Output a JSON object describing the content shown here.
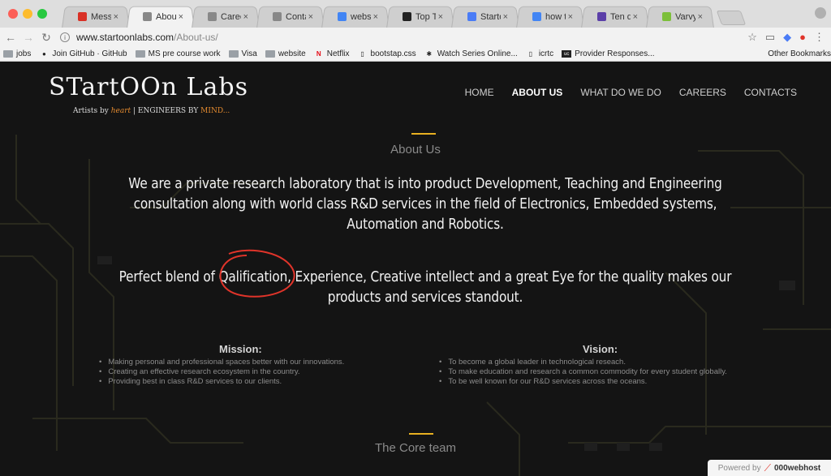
{
  "browser": {
    "tabs": [
      {
        "title": "Message (",
        "icon": "gmail-icon",
        "color": "#d93025"
      },
      {
        "title": "About",
        "icon": "page-icon",
        "color": "#888888",
        "active": true
      },
      {
        "title": "Careers",
        "icon": "page-icon",
        "color": "#888888"
      },
      {
        "title": "Contacts",
        "icon": "page-icon",
        "color": "#888888"
      },
      {
        "title": "website de",
        "icon": "google-icon",
        "color": "#4285f4"
      },
      {
        "title": "Top Ten Re",
        "icon": "logo-icon",
        "color": "#222222"
      },
      {
        "title": "Startoonla",
        "icon": "docs-icon",
        "color": "#4a7cf6"
      },
      {
        "title": "how to tes",
        "icon": "google-icon",
        "color": "#4285f4"
      },
      {
        "title": "Ten quick",
        "icon": "w-icon",
        "color": "#5b3fa8"
      },
      {
        "title": "Varvy SEO",
        "icon": "leaf-icon",
        "color": "#7cbf3a"
      }
    ],
    "url_host": "www.startoonlabs.com",
    "url_path": "/About-us/",
    "bookmarks": [
      {
        "label": "jobs",
        "icon": "folder-icon"
      },
      {
        "label": "Join GitHub · GitHub",
        "icon": "github-icon"
      },
      {
        "label": "MS pre course work",
        "icon": "folder-icon"
      },
      {
        "label": "Visa",
        "icon": "folder-icon"
      },
      {
        "label": "website",
        "icon": "folder-icon"
      },
      {
        "label": "Netflix",
        "icon": "netflix-icon"
      },
      {
        "label": "bootstap.css",
        "icon": "file-icon"
      },
      {
        "label": "Watch Series Online...",
        "icon": "series-icon"
      },
      {
        "label": "icrtc",
        "icon": "file-icon"
      },
      {
        "label": "Provider Responses...",
        "icon": "uc-icon"
      }
    ],
    "other_bookmarks": "Other Bookmarks"
  },
  "site": {
    "logo_text": "STartOOn Labs",
    "tagline_pre": "Artists by ",
    "tagline_heart": "heart",
    "tagline_mid": " | ENGINEERS BY ",
    "tagline_mind": "MIND...",
    "nav": [
      "HOME",
      "ABOUT US",
      "WHAT DO WE DO",
      "CAREERS",
      "CONTACTS"
    ],
    "nav_active": "ABOUT US"
  },
  "about": {
    "title": "About Us",
    "p1_l1": "We are a private research laboratory that is into product Development, Teaching and Engineering",
    "p1_l2": "consultation along with world class R&D services in the field of Electronics, Embedded systems,",
    "p1_l3": "Automation and Robotics.",
    "p2_l1": "Perfect blend of Qalification, Experience, Creative intellect and a great Eye for the quality makes our",
    "p2_l2": "products and services standout."
  },
  "mission": {
    "title": "Mission:",
    "items": [
      "Making personal and professional spaces better with our innovations.",
      "Creating an effective research ecosystem in the country.",
      "Providing best in class R&D services to our clients."
    ]
  },
  "vision": {
    "title": "Vision:",
    "items": [
      "To become a global leader in technological reseach.",
      "To make education and research a common commodity for every student globally.",
      "To be well known for our R&D services across the oceans."
    ]
  },
  "core_team": {
    "title": "The Core team"
  },
  "footer": {
    "powered_by": "Powered by",
    "host": "000webhost"
  },
  "colors": {
    "accent": "#e8b021",
    "annotation": "#e0342a",
    "background": "#141414"
  }
}
